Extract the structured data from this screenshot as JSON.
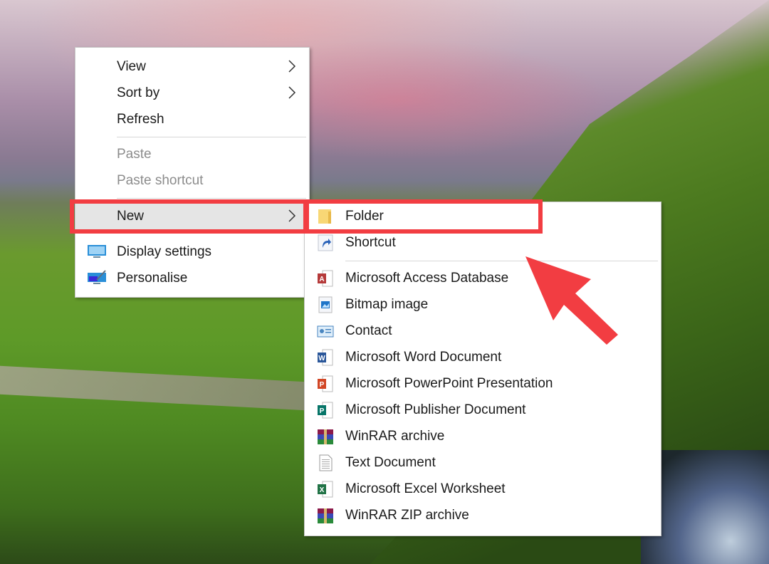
{
  "desktop": {
    "context_menu": {
      "items": [
        {
          "label": "View",
          "has_submenu": true,
          "enabled": true
        },
        {
          "label": "Sort by",
          "has_submenu": true,
          "enabled": true
        },
        {
          "label": "Refresh",
          "has_submenu": false,
          "enabled": true
        },
        {
          "label": "Paste",
          "has_submenu": false,
          "enabled": false
        },
        {
          "label": "Paste shortcut",
          "has_submenu": false,
          "enabled": false
        },
        {
          "label": "New",
          "has_submenu": true,
          "enabled": true,
          "highlighted": true
        },
        {
          "label": "Display settings",
          "icon": "display-icon",
          "enabled": true
        },
        {
          "label": "Personalise",
          "icon": "personalise-icon",
          "enabled": true
        }
      ]
    },
    "new_submenu": {
      "items": [
        {
          "label": "Folder",
          "icon": "folder-icon"
        },
        {
          "label": "Shortcut",
          "icon": "shortcut-icon"
        },
        {
          "label": "Microsoft Access Database",
          "icon": "access-icon"
        },
        {
          "label": "Bitmap image",
          "icon": "bitmap-icon"
        },
        {
          "label": "Contact",
          "icon": "contact-icon"
        },
        {
          "label": "Microsoft Word Document",
          "icon": "word-icon"
        },
        {
          "label": "Microsoft PowerPoint Presentation",
          "icon": "powerpoint-icon"
        },
        {
          "label": "Microsoft Publisher Document",
          "icon": "publisher-icon"
        },
        {
          "label": "WinRAR archive",
          "icon": "winrar-icon"
        },
        {
          "label": "Text Document",
          "icon": "text-document-icon"
        },
        {
          "label": "Microsoft Excel Worksheet",
          "icon": "excel-icon"
        },
        {
          "label": "WinRAR ZIP archive",
          "icon": "winrar-zip-icon"
        }
      ]
    },
    "annotation": {
      "highlight_color": "#f23d42",
      "highlighted_items": [
        "New",
        "Folder"
      ]
    }
  }
}
